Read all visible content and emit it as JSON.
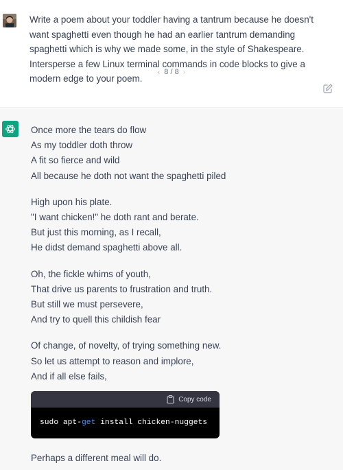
{
  "user": {
    "prompt": "Write a poem about your toddler having a tantrum because he doesn't want spaghetti even though he had an earlier tantrum demanding spaghetti which is why we made some, in the style of Shakespeare. Intersperse a few Linux terminal commands in code blocks to give a modern edge to your poem.",
    "pager_prev": "‹",
    "pager_label": "8 / 8",
    "pager_next": "›"
  },
  "assistant": {
    "stanzas": [
      [
        "Once more the tears do flow",
        "As my toddler doth throw",
        "A fit so fierce and wild",
        "All because he doth not want the spaghetti piled"
      ],
      [
        "High upon his plate.",
        "\"I want chicken!\" he doth rant and berate.",
        "But just this morning, as I recall,",
        "He didst demand spaghetti above all."
      ],
      [
        "Oh, the fickle whims of youth,",
        "That drive us parents to frustration and truth.",
        "But still we must persevere,",
        "And try to quell this childish fear"
      ],
      [
        "Of change, of novelty, of trying something new.",
        "So let us attempt to reason and implore,",
        "And if all else fails,"
      ]
    ],
    "code": {
      "copy_label": "Copy code",
      "before": "sudo apt-",
      "keyword": "get",
      "after": " install chicken-nuggets"
    },
    "closing_line": "Perhaps a different meal will do."
  },
  "icons": {
    "edit": "edit-icon",
    "assistant_logo": "openai-logo-icon",
    "copy": "clipboard-icon"
  },
  "colors": {
    "assistant_logo_bg": "#10a37f",
    "code_header_bg": "#343541",
    "code_bg": "#000000",
    "code_keyword": "#4e8ee0",
    "assistant_bg": "#f7f7f8"
  }
}
